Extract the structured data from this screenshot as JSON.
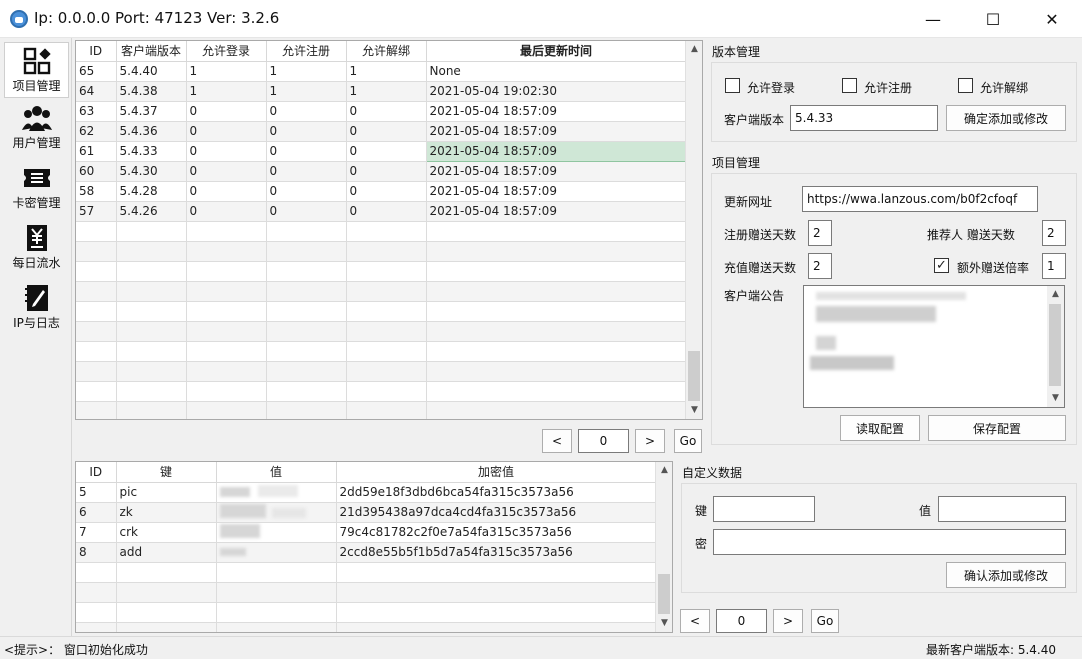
{
  "window": {
    "title": "Ip: 0.0.0.0  Port: 47123  Ver: 3.2.6",
    "minimize": "—",
    "maximize": "☐",
    "close": "✕"
  },
  "sidebar": {
    "items": [
      {
        "label": "项目管理",
        "icon": "grid-shapes-icon"
      },
      {
        "label": "用户管理",
        "icon": "users-icon"
      },
      {
        "label": "卡密管理",
        "icon": "ticket-icon"
      },
      {
        "label": "每日流水",
        "icon": "yuan-receipt-icon"
      },
      {
        "label": "IP与日志",
        "icon": "notebook-pen-icon"
      }
    ]
  },
  "version_table": {
    "columns": [
      "ID",
      "客户端版本",
      "允许登录",
      "允许注册",
      "允许解绑",
      "最后更新时间"
    ],
    "rows": [
      [
        "65",
        "5.4.40",
        "1",
        "1",
        "1",
        "None"
      ],
      [
        "64",
        "5.4.38",
        "1",
        "1",
        "1",
        "2021-05-04 19:02:30"
      ],
      [
        "63",
        "5.4.37",
        "0",
        "0",
        "0",
        "2021-05-04 18:57:09"
      ],
      [
        "62",
        "5.4.36",
        "0",
        "0",
        "0",
        "2021-05-04 18:57:09"
      ],
      [
        "61",
        "5.4.33",
        "0",
        "0",
        "0",
        "2021-05-04 18:57:09"
      ],
      [
        "60",
        "5.4.30",
        "0",
        "0",
        "0",
        "2021-05-04 18:57:09"
      ],
      [
        "58",
        "5.4.28",
        "0",
        "0",
        "0",
        "2021-05-04 18:57:09"
      ],
      [
        "57",
        "5.4.26",
        "0",
        "0",
        "0",
        "2021-05-04 18:57:09"
      ]
    ]
  },
  "version_pager": {
    "prev": "<",
    "page": "0",
    "next": ">",
    "go": "Go"
  },
  "version_mgmt": {
    "title": "版本管理",
    "allow_login": "允许登录",
    "allow_register": "允许注册",
    "allow_unbind": "允许解绑",
    "client_version_label": "客户端版本",
    "client_version_value": "5.4.33",
    "confirm_button": "确定添加或修改"
  },
  "project_mgmt": {
    "title": "项目管理",
    "update_url_label": "更新网址",
    "update_url_value": "https://wwa.lanzous.com/b0f2cfoqf",
    "register_days_label": "注册赠送天数",
    "register_days_value": "2",
    "referrer_days_label": "推荐人 赠送天数",
    "referrer_days_value": "2",
    "recharge_days_label": "充值赠送天数",
    "recharge_days_value": "2",
    "extra_multiplier_label": "额外赠送倍率",
    "extra_multiplier_value": "1",
    "extra_multiplier_checked": "✓",
    "notice_label": "客户端公告",
    "read_button": "读取配置",
    "save_button": "保存配置"
  },
  "custom_table": {
    "columns": [
      "ID",
      "键",
      "值",
      "加密值"
    ],
    "rows": [
      [
        "5",
        "pic",
        "",
        "2dd59e18f3dbd6bca54fa315c3573a56"
      ],
      [
        "6",
        "zk",
        "",
        "21d395438a97dca4cd4fa315c3573a56"
      ],
      [
        "7",
        "crk",
        "",
        "79c4c81782c2f0e7a54fa315c3573a56"
      ],
      [
        "8",
        "add",
        "",
        "2ccd8e55b5f1b5d7a54fa315c3573a56"
      ]
    ]
  },
  "custom_data": {
    "title": "自定义数据",
    "key_label": "键",
    "value_label": "值",
    "secret_label": "密",
    "confirm_button": "确认添加或修改"
  },
  "custom_pager": {
    "prev": "<",
    "page": "0",
    "next": ">",
    "go": "Go"
  },
  "status": {
    "hint": "<提示>：  窗口初始化成功",
    "latest_version": "最新客户端版本: 5.4.40"
  }
}
